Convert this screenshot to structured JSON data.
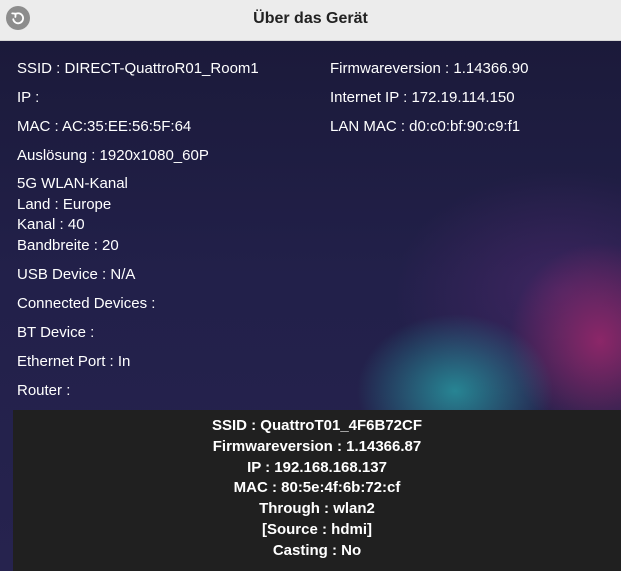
{
  "header": {
    "title": "Über das Gerät",
    "back_icon": "back-arrow-icon"
  },
  "left": {
    "ssid": "SSID : DIRECT-QuattroR01_Room1",
    "ip": "IP :",
    "mac": "MAC : AC:35:EE:56:5F:64",
    "resolution": "Auslösung : 1920x1080_60P",
    "wlan5g": {
      "title": "5G WLAN-Kanal",
      "country": "Land : Europe",
      "channel": "Kanal : 40",
      "bandwidth": "Bandbreite : 20"
    },
    "usb": "USB Device : N/A",
    "connected": "Connected Devices :",
    "bt": "BT Device :",
    "ethernet": "Ethernet Port : In",
    "router": "Router :"
  },
  "right": {
    "firmware": "Firmwareversion : 1.14366.90",
    "internet_ip": "Internet IP : 172.19.114.150",
    "lan_mac": "LAN MAC : d0:c0:bf:90:c9:f1"
  },
  "panel": {
    "ssid": "SSID : QuattroT01_4F6B72CF",
    "firmware": "Firmwareversion : 1.14366.87",
    "ip": "IP : 192.168.168.137",
    "mac": "MAC : 80:5e:4f:6b:72:cf",
    "through": "Through : wlan2",
    "source": "[Source : hdmi]",
    "casting": "Casting : No"
  },
  "colors": {
    "header_bg": "#ececec",
    "main_bg": "#1b1a3a",
    "panel_bg": "#202020",
    "text": "#ffffff"
  }
}
